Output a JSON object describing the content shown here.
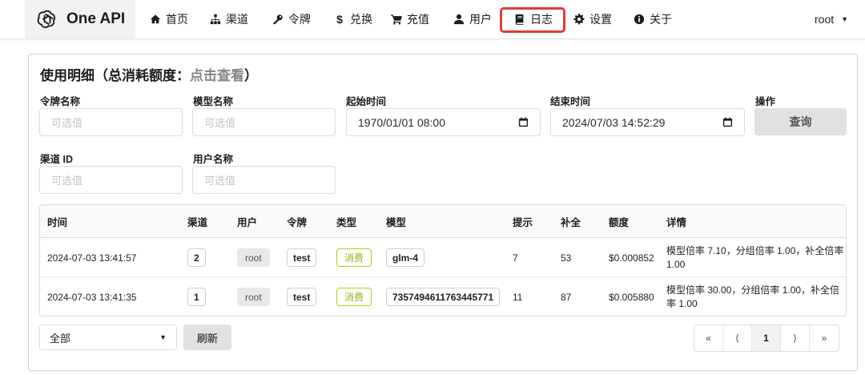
{
  "brand": {
    "name": "One API"
  },
  "nav": [
    {
      "label": "首页",
      "icon": "home-icon"
    },
    {
      "label": "渠道",
      "icon": "sitemap-icon"
    },
    {
      "label": "令牌",
      "icon": "key-icon"
    },
    {
      "label": "兑换",
      "icon": "dollar-icon"
    },
    {
      "label": "充值",
      "icon": "cart-icon"
    },
    {
      "label": "用户",
      "icon": "user-icon"
    },
    {
      "label": "日志",
      "icon": "book-icon"
    },
    {
      "label": "设置",
      "icon": "gear-icon"
    },
    {
      "label": "关于",
      "icon": "info-icon"
    }
  ],
  "user_menu": {
    "label": "root"
  },
  "card": {
    "title": "使用明细（总消耗额度：",
    "title_link": "点击查看",
    "title_end": "）"
  },
  "filters": {
    "token_name": {
      "label": "令牌名称",
      "placeholder": "可选值"
    },
    "model_name": {
      "label": "模型名称",
      "placeholder": "可选值"
    },
    "start_time": {
      "label": "起始时间",
      "value": "1970/01/01 08:00"
    },
    "end_time": {
      "label": "结束时间",
      "value": "2024/07/03 14:52:29"
    },
    "action": {
      "label": "操作",
      "button": "查询"
    },
    "channel_id": {
      "label": "渠道 ID",
      "placeholder": "可选值"
    },
    "username": {
      "label": "用户名称",
      "placeholder": "可选值"
    }
  },
  "table": {
    "headers": [
      "时间",
      "渠道",
      "用户",
      "令牌",
      "类型",
      "模型",
      "提示",
      "补全",
      "额度",
      "详情"
    ],
    "rows": [
      {
        "time": "2024-07-03 13:41:57",
        "channel": "2",
        "user": "root",
        "token": "test",
        "type": "消费",
        "model": "glm-4",
        "prompt": "7",
        "completion": "53",
        "quota": "$0.000852",
        "detail": "模型倍率 7.10，分组倍率 1.00，补全倍率 1.00"
      },
      {
        "time": "2024-07-03 13:41:35",
        "channel": "1",
        "user": "root",
        "token": "test",
        "type": "消费",
        "model": "7357494611763445771",
        "prompt": "11",
        "completion": "87",
        "quota": "$0.005880",
        "detail": "模型倍率 30.00，分组倍率 1.00，补全倍率 1.00"
      }
    ]
  },
  "footer": {
    "log_type_select": "全部",
    "refresh_button": "刷新",
    "pagination": {
      "first": "«",
      "prev": "⟨",
      "current": "1",
      "next": "⟩",
      "last": "»"
    }
  },
  "colors": {
    "highlight": "#e03a3a",
    "consume_label": "#b5cc18"
  }
}
